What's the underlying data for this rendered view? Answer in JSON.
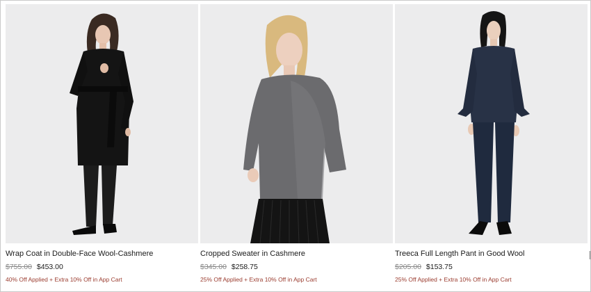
{
  "products": [
    {
      "name": "Wrap Coat in Double-Face Wool-Cashmere",
      "original_price": "$755.00",
      "sale_price": "$453.00",
      "promo": "40% Off Applied + Extra 10% Off in App Cart"
    },
    {
      "name": "Cropped Sweater in Cashmere",
      "original_price": "$345.00",
      "sale_price": "$258.75",
      "promo": "25% Off Applied + Extra 10% Off in App Cart"
    },
    {
      "name": "Treeca Full Length Pant in Good Wool",
      "original_price": "$205.00",
      "sale_price": "$153.75",
      "promo": "25% Off Applied + Extra 10% Off in App Cart"
    }
  ],
  "colors": {
    "promo_text": "#9a3b2e",
    "image_background": "#ececed",
    "strikethrough_price": "#8a8a8a"
  }
}
